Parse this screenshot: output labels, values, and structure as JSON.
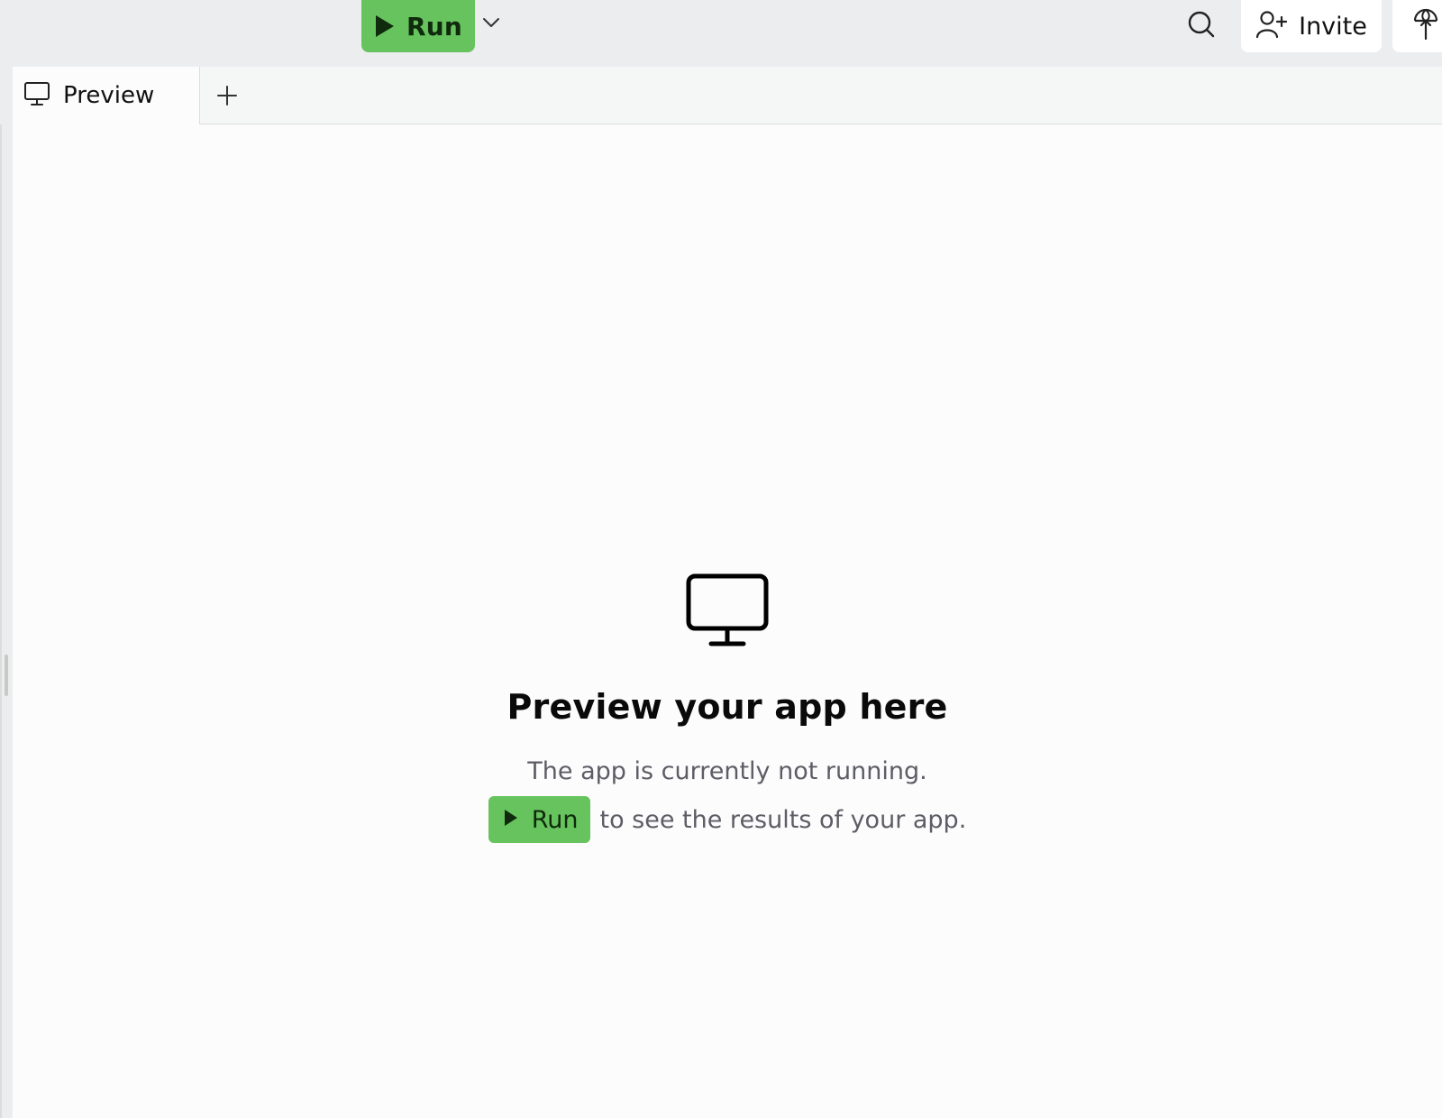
{
  "topbar": {
    "run_label": "Run",
    "invite_label": "Invite",
    "icons": {
      "run": "play-icon",
      "run_options": "chevron-down-icon",
      "search": "search-icon",
      "invite": "user-plus-icon",
      "deploy": "deploy-icon"
    }
  },
  "tabs": [
    {
      "label": "Preview",
      "icon": "monitor-icon",
      "active": true
    }
  ],
  "add_tab_icon": "plus-icon",
  "empty_state": {
    "icon": "monitor-icon",
    "title": "Preview your app here",
    "line1": "The app is currently not running.",
    "run_label": "Run",
    "line2_suffix": "to see the results of your app."
  },
  "colors": {
    "run_green": "#67c35e",
    "background": "#ecedee",
    "panel": "#fcfcfc",
    "muted_text": "#5d5d66"
  }
}
